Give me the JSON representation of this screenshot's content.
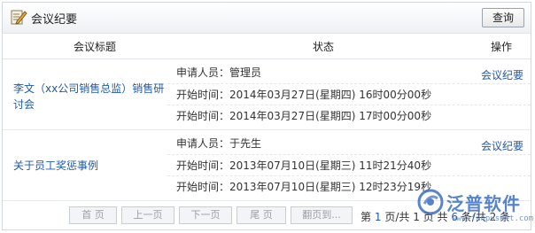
{
  "header": {
    "title": "会议纪要",
    "query_label": "查询"
  },
  "columns": {
    "topic": "会议标题",
    "status": "状态",
    "action": "操作"
  },
  "rows": [
    {
      "topic": "李文（xx公司销售总监）销售研讨会",
      "applicant": "申请人员：管理员",
      "start": "开始时间：2014年03月27日(星期四) 16时00分00秒",
      "end": "开始时间：2014年03月27日(星期四) 17时00分00秒",
      "action": "会议纪要"
    },
    {
      "topic": "关于员工奖惩事例",
      "applicant": "申请人员：于先生",
      "start": "开始时间：2013年07月10日(星期三) 11时21分40秒",
      "end": "开始时间：2013年07月10日(星期三) 12时23分19秒",
      "action": "会议纪要"
    }
  ],
  "pager": {
    "first": "首 页",
    "prev": "上一页",
    "next": "下一页",
    "last": "尾 页",
    "jump": "翻页到...",
    "info_prefix": "第",
    "current": "1",
    "info_mid": "页/共",
    "total_pages": "1",
    "info_mid2": "页 共",
    "total_records": "6",
    "info_mid3": "条/共",
    "tail": "2 条"
  },
  "watermark": {
    "text": "泛普软件",
    "url": "www.fanpusoft.com"
  },
  "colors": {
    "link": "#1e5aa8",
    "border": "#d2d8df",
    "watermark": "#3b6fc4"
  },
  "icons": {
    "title": "edit-note-icon",
    "watermark": "fanpu-logo-icon"
  }
}
